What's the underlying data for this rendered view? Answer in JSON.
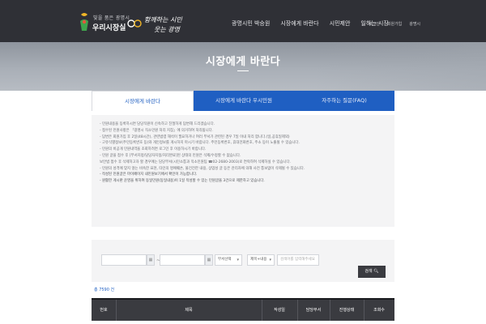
{
  "header": {
    "logo_line1": "빛을 품은 광명시",
    "logo_line2": "우리시장실",
    "brand_slogan": "함께하는 시민 웃는 광명",
    "nav": [
      "광명시민 박승원",
      "시장에게 바란다",
      "시민제안",
      "일하는 시장"
    ],
    "util": [
      "로그인",
      "회원가입",
      "광명시"
    ]
  },
  "hero": {
    "title": "시장에게 바란다"
  },
  "tabs": [
    "시장에게 바란다",
    "시장에게 바란다 우시민원",
    "자주하는 질문(FAQ)"
  ],
  "notice": {
    "items": [
      "- 민원내용을 등록하시면 담당직원이 신속하고 친절하게 답변해 드리겠습니다.",
      "- 접수된 민원사항은 「광명시 직소민원 처리 지침」에 의거하여 처리됩니다.",
      "- 답변은 회원가입 후 2일(48시간), 관련법령 해석이 필요하거나 여러 부서가 관련된 경우 7일 이내 처리 합니다.(일,공휴일제외)",
      "- 고유식별정보(주민등록번호 등)와 개인정보를 게시하지 마시기 바랍니다. 주민등록번호, 휴대전화번호, 주소 등이 노출될 수 있습니다.",
      "- 민원의 비공개 민원내역을 조회하려면 로그인 후 이용하시기 바랍니다.",
      "- 민원 글을 접수 후 [부서지정/담당자지정/처리완료]된 상태의 민원은 삭제/수정할 수 없습니다.",
      "  보안법 접수 후 삭제하고자 할 경우에는 담당부서(시민소통과 직소민원팀 ☎02-2680-2003)로 연락하여 삭제하실 수 있습니다.",
      "- 민원의 성격에 맞지 않는 비속한 표현, 타인의 명예훼손, 불건전한 내용, 상업성 글 등은 관리자에 의해 사전 통보없이 삭제될 수 있습니다.",
      "- 작성된 민원글은 마이페이지 내민원보기에서 확인이 가능합니다.",
      "- 원활한 게시판 운영을 위하여 동일민원(동일내용)이 1일 작성할 수 있는 민원글을 3건으로 제한하고 있습니다."
    ]
  },
  "search": {
    "select_dept": "부서선택",
    "select_field": "제목+내용",
    "keyword_placeholder": "검색어를 입력해주세요",
    "button": "검색"
  },
  "total_text": "총 7590 건",
  "table": {
    "headers": [
      "번호",
      "제목",
      "작성일",
      "담당부서",
      "진행상태",
      "조회수"
    ]
  },
  "colors": {
    "header_bg": "#2f3036",
    "accent_blue": "#1f5fc2",
    "panel_bg": "#f4f4f5"
  },
  "icons": {
    "logo": "city-logo-icon",
    "calendar": "calendar-icon",
    "search": "search-icon"
  }
}
